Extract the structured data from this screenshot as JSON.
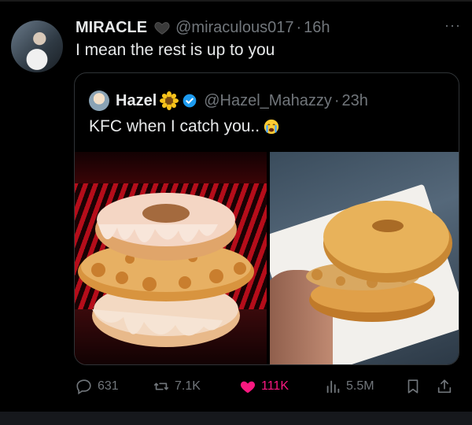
{
  "tweet": {
    "author_name": "MIRACLE",
    "author_handle": "@miraculous017",
    "separator": "·",
    "time": "16h",
    "text": "I mean the rest is up to you",
    "more": "···"
  },
  "quoted": {
    "author_name": "Hazel",
    "author_handle": "@Hazel_Mahazzy",
    "separator": "·",
    "time": "23h",
    "text": "KFC when I catch you.."
  },
  "actions": {
    "replies": "631",
    "reposts": "7.1K",
    "likes": "111K",
    "views": "5.5M"
  },
  "colors": {
    "background": "#000000",
    "text": "#e7e9ea",
    "muted": "#71767b",
    "like": "#f91880",
    "verified": "#1d9bf0"
  },
  "icons": [
    "black-heart-icon",
    "sunflower-icon",
    "verified-badge-icon",
    "crying-emoji-icon",
    "reply-icon",
    "repost-icon",
    "like-icon",
    "views-icon",
    "bookmark-icon",
    "share-icon",
    "more-icon"
  ]
}
